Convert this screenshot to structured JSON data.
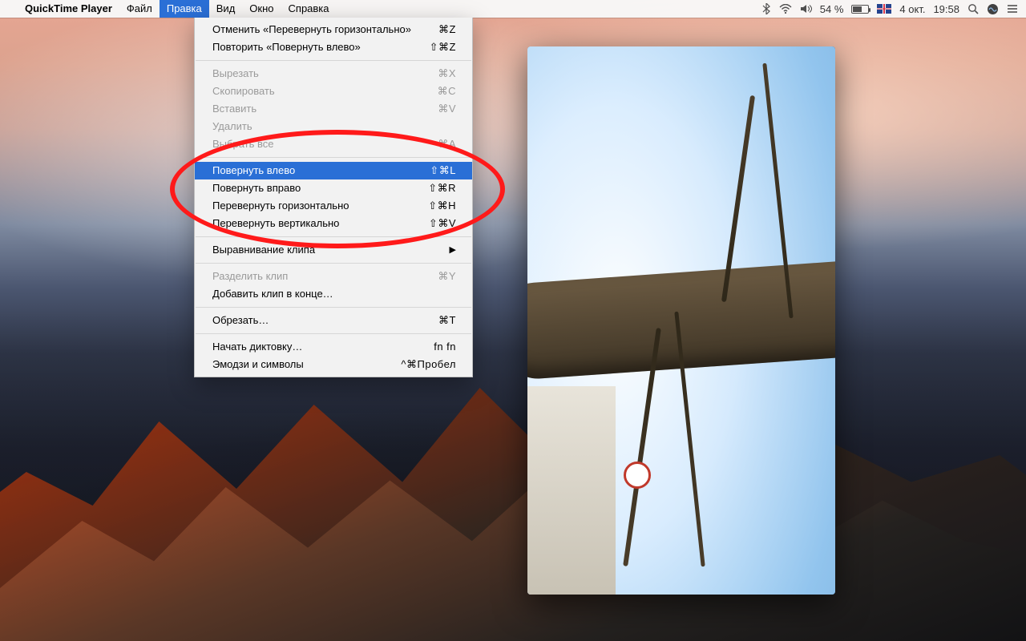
{
  "menubar": {
    "app_name": "QuickTime Player",
    "items": [
      {
        "label": "Файл",
        "active": false
      },
      {
        "label": "Правка",
        "active": true
      },
      {
        "label": "Вид",
        "active": false
      },
      {
        "label": "Окно",
        "active": false
      },
      {
        "label": "Справка",
        "active": false
      }
    ],
    "status": {
      "battery_text": "54 %",
      "date_text": "4 окт.",
      "time_text": "19:58"
    }
  },
  "dropdown": {
    "groups": [
      [
        {
          "label": "Отменить «Перевернуть горизонтально»",
          "shortcut": "⌘Z",
          "disabled": false
        },
        {
          "label": "Повторить «Повернуть влево»",
          "shortcut": "⇧⌘Z",
          "disabled": false
        }
      ],
      [
        {
          "label": "Вырезать",
          "shortcut": "⌘X",
          "disabled": true
        },
        {
          "label": "Скопировать",
          "shortcut": "⌘C",
          "disabled": true
        },
        {
          "label": "Вставить",
          "shortcut": "⌘V",
          "disabled": true
        },
        {
          "label": "Удалить",
          "shortcut": "",
          "disabled": true
        },
        {
          "label": "Выбрать все",
          "shortcut": "⌘A",
          "disabled": true
        }
      ],
      [
        {
          "label": "Повернуть влево",
          "shortcut": "⇧⌘L",
          "disabled": false,
          "highlight": true
        },
        {
          "label": "Повернуть вправо",
          "shortcut": "⇧⌘R",
          "disabled": false
        },
        {
          "label": "Перевернуть горизонтально",
          "shortcut": "⇧⌘H",
          "disabled": false
        },
        {
          "label": "Перевернуть вертикально",
          "shortcut": "⇧⌘V",
          "disabled": false
        }
      ],
      [
        {
          "label": "Выравнивание клипа",
          "shortcut": "",
          "submenu": true,
          "disabled": false
        }
      ],
      [
        {
          "label": "Разделить клип",
          "shortcut": "⌘Y",
          "disabled": true
        },
        {
          "label": "Добавить клип в конце…",
          "shortcut": "",
          "disabled": false
        }
      ],
      [
        {
          "label": "Обрезать…",
          "shortcut": "⌘T",
          "disabled": false
        }
      ],
      [
        {
          "label": "Начать диктовку…",
          "shortcut": "fn fn",
          "disabled": false
        },
        {
          "label": "Эмодзи и символы",
          "shortcut": "^⌘Пробел",
          "disabled": false
        }
      ]
    ]
  },
  "annotation": {
    "highlight_ellipse_color": "#ff1a1a"
  }
}
